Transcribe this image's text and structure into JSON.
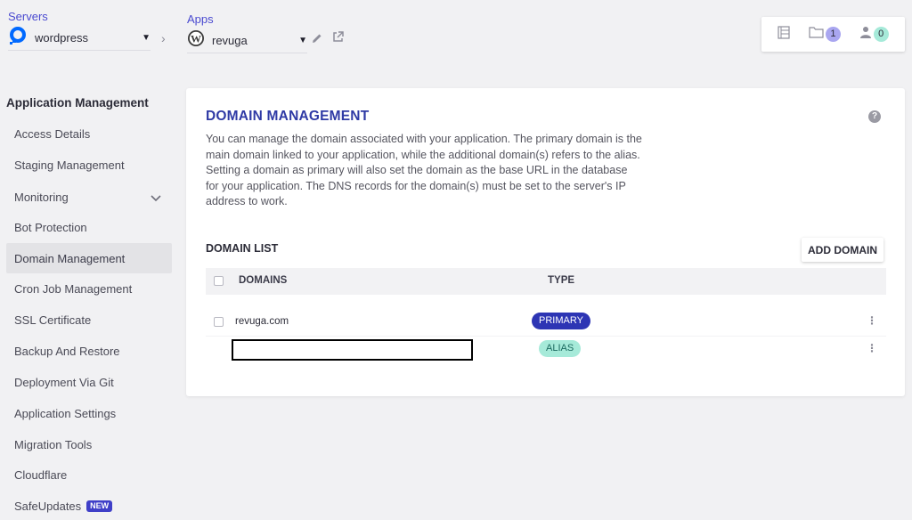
{
  "topbar": {
    "servers_label": "Servers",
    "server_selected": "wordpress",
    "apps_label": "Apps",
    "app_selected": "revuga",
    "folder_count": "1",
    "users_count": "0",
    "colors": {
      "accent": "#4a4ad0",
      "folder_badge": "#a9a6f0",
      "users_badge": "#a6ead9"
    },
    "icons": [
      "digitalocean-icon",
      "wordpress-icon",
      "pencil-icon",
      "external-link-icon",
      "server-list-icon",
      "folder-icon",
      "user-icon"
    ]
  },
  "sidebar": {
    "title": "Application Management",
    "items": [
      {
        "label": "Access Details"
      },
      {
        "label": "Staging Management"
      },
      {
        "label": "Monitoring"
      },
      {
        "label": "Bot Protection"
      },
      {
        "label": "Domain Management",
        "active": true
      },
      {
        "label": "Cron Job Management"
      },
      {
        "label": "SSL Certificate"
      },
      {
        "label": "Backup And Restore"
      },
      {
        "label": "Deployment Via Git"
      },
      {
        "label": "Application Settings"
      },
      {
        "label": "Migration Tools"
      },
      {
        "label": "Cloudflare"
      },
      {
        "label": "SafeUpdates",
        "badge": "NEW"
      }
    ]
  },
  "main": {
    "title": "DOMAIN MANAGEMENT",
    "description": "You can manage the domain associated with your application. The primary domain is the main domain linked to your application, while the additional domain(s) refers to the alias. Setting a domain as primary will also set the domain as the base URL in the database for your application. The DNS records for the domain(s) must be set to the server's IP address to work.",
    "domain_list_title": "DOMAIN LIST",
    "add_domain_label": "ADD DOMAIN",
    "columns": {
      "domains": "DOMAINS",
      "type": "TYPE"
    },
    "rows": [
      {
        "domain": "revuga.com",
        "type": "PRIMARY"
      },
      {
        "domain": "",
        "type": "ALIAS"
      }
    ],
    "colors": {
      "title": "#2f3aa5",
      "primary_pill": "#2d35b4",
      "alias_pill": "#a6ead9"
    }
  }
}
